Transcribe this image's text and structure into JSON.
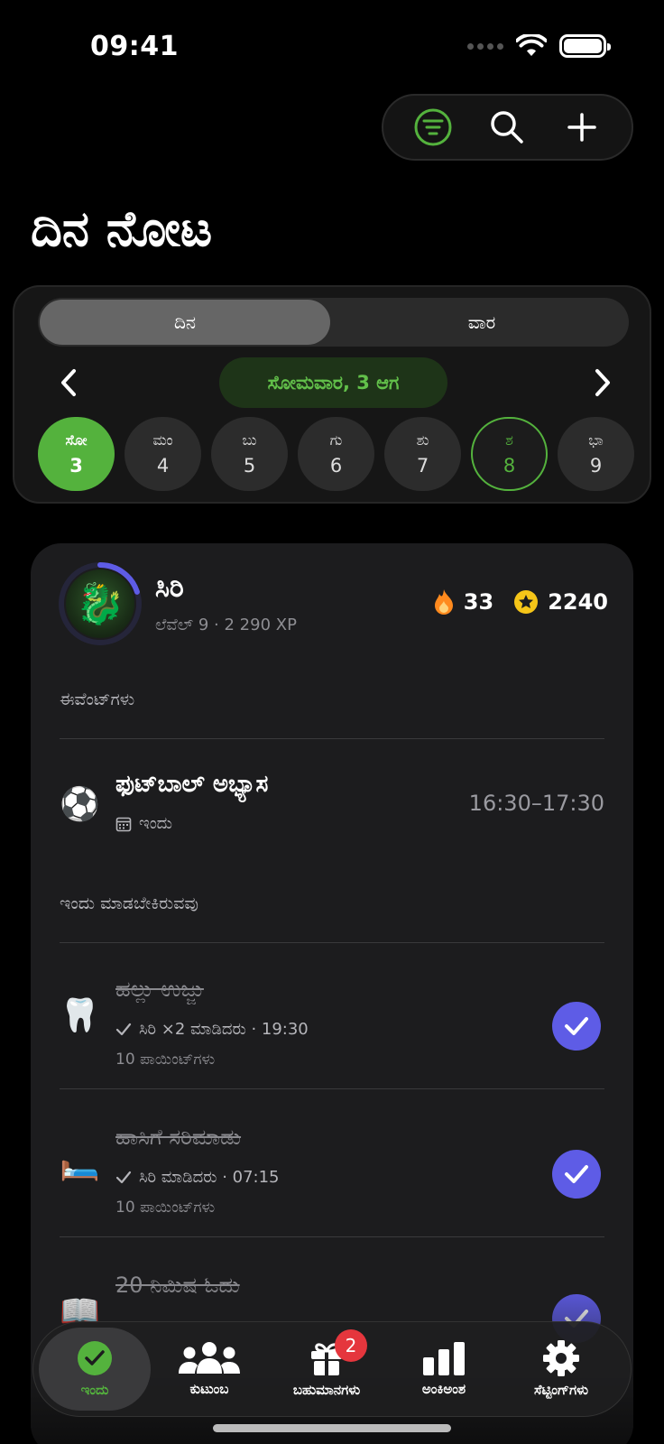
{
  "status_bar": {
    "time": "09:41"
  },
  "header": {
    "title": "ದಿನ ನೋಟ"
  },
  "segment": {
    "day": "ದಿನ",
    "week": "ವಾರ"
  },
  "date_nav": {
    "current": "ಸೋಮವಾರ, 3 ಆಗ"
  },
  "days": [
    {
      "name": "ಸೋ",
      "num": "3"
    },
    {
      "name": "ಮಂ",
      "num": "4"
    },
    {
      "name": "ಬು",
      "num": "5"
    },
    {
      "name": "ಗು",
      "num": "6"
    },
    {
      "name": "ಶು",
      "num": "7"
    },
    {
      "name": "ಶ",
      "num": "8"
    },
    {
      "name": "ಭಾ",
      "num": "9"
    }
  ],
  "profile": {
    "name": "ಸಿರಿ",
    "subtitle": "ಲೆವೆಲ್ 9 · 2 290 XP",
    "streak": "33",
    "coins": "2240",
    "level_progress": 0.2
  },
  "events_section": {
    "label": "ಈವೆಂಟ್‌ಗಳು",
    "event": {
      "title": "ಫುಟ್‌ಬಾಲ್ ಅಭ್ಯಾಸ",
      "date": "ಇಂದು",
      "time": "16:30–17:30",
      "icon": "soccer-ball"
    }
  },
  "todo_section": {
    "label": "ಇಂದು ಮಾಡಬೇಕಿರುವವು",
    "tasks": [
      {
        "title": "ಹಲ್ಲು ಉಜ್ಜು",
        "meta": "ಸಿರಿ ×2 ಮಾಡಿದರು · 19:30",
        "points": "10 ಪಾಯಿಂಟ್‌ಗಳು",
        "icon": "tooth"
      },
      {
        "title": "ಹಾಸಿಗೆ ಸರಿಮಾಡು",
        "meta": "ಸಿರಿ ಮಾಡಿದರು · 07:15",
        "points": "10 ಪಾಯಿಂಟ್‌ಗಳು",
        "icon": "bed"
      },
      {
        "title": "20 ನಿಮಿಷ ಓದು",
        "meta": "",
        "points": "",
        "icon": "book"
      }
    ]
  },
  "tab_bar": {
    "today": "ಇಂದು",
    "family": "ಕುಟುಂಬ",
    "rewards": "ಬಹುಮಾನಗಳು",
    "rewards_badge": "2",
    "stats": "ಅಂಕಿಅಂಶ",
    "settings": "ಸೆಟ್ಟಿಂಗ್‌ಗಳು"
  },
  "colors": {
    "accent_green": "#54b23d",
    "accent_purple": "#5e5ce6",
    "badge_red": "#e5363d"
  }
}
